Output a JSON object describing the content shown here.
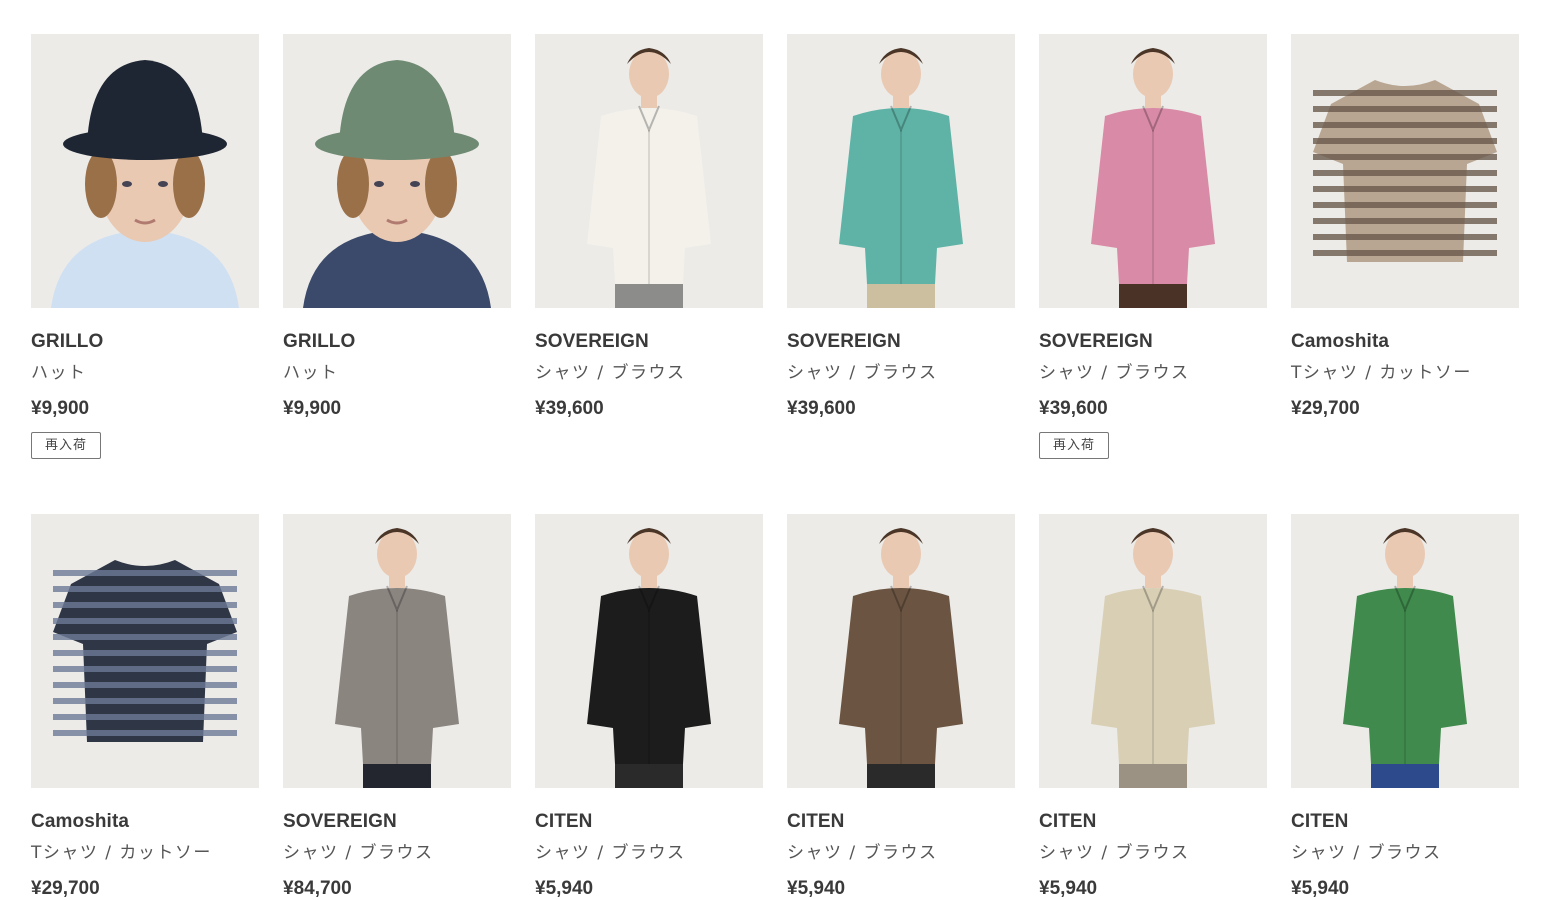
{
  "products": [
    {
      "brand": "GRILLO",
      "category": "ハット",
      "price": "¥9,900",
      "badge": "再入荷",
      "image": "navy-bucket-hat"
    },
    {
      "brand": "GRILLO",
      "category": "ハット",
      "price": "¥9,900",
      "badge": "",
      "image": "green-bucket-hat"
    },
    {
      "brand": "SOVEREIGN",
      "category": "シャツ / ブラウス",
      "price": "¥39,600",
      "badge": "",
      "image": "white-shirt"
    },
    {
      "brand": "SOVEREIGN",
      "category": "シャツ / ブラウス",
      "price": "¥39,600",
      "badge": "",
      "image": "teal-shirt"
    },
    {
      "brand": "SOVEREIGN",
      "category": "シャツ / ブラウス",
      "price": "¥39,600",
      "badge": "再入荷",
      "image": "pink-shirt"
    },
    {
      "brand": "Camoshita",
      "category": "Tシャツ / カットソー",
      "price": "¥29,700",
      "badge": "",
      "image": "brown-stripe-tee"
    },
    {
      "brand": "Camoshita",
      "category": "Tシャツ / カットソー",
      "price": "¥29,700",
      "badge": "",
      "image": "navy-stripe-tee"
    },
    {
      "brand": "SOVEREIGN",
      "category": "シャツ / ブラウス",
      "price": "¥84,700",
      "badge": "",
      "image": "check-jacket"
    },
    {
      "brand": "CITEN",
      "category": "シャツ / ブラウス",
      "price": "¥5,940",
      "badge": "",
      "image": "black-open-collar-shirt"
    },
    {
      "brand": "CITEN",
      "category": "シャツ / ブラウス",
      "price": "¥5,940",
      "badge": "",
      "image": "brown-open-collar-shirt"
    },
    {
      "brand": "CITEN",
      "category": "シャツ / ブラウス",
      "price": "¥5,940",
      "badge": "",
      "image": "beige-open-collar-shirt"
    },
    {
      "brand": "CITEN",
      "category": "シャツ / ブラウス",
      "price": "¥5,940",
      "badge": "",
      "image": "green-open-collar-shirt"
    }
  ],
  "colors": {
    "navy-bucket-hat": "#1f2633",
    "green-bucket-hat": "#6f8a72",
    "white-shirt": "#f3f1ea",
    "teal-shirt": "#5fb3a6",
    "pink-shirt": "#d98aa6",
    "brown-stripe-tee": "#6a5a4c",
    "navy-stripe-tee": "#3c4456",
    "check-jacket": "#8b8580",
    "black-open-collar-shirt": "#1c1c1c",
    "brown-open-collar-shirt": "#6b5542",
    "beige-open-collar-shirt": "#d9cfb5",
    "green-open-collar-shirt": "#3f8a4c"
  }
}
